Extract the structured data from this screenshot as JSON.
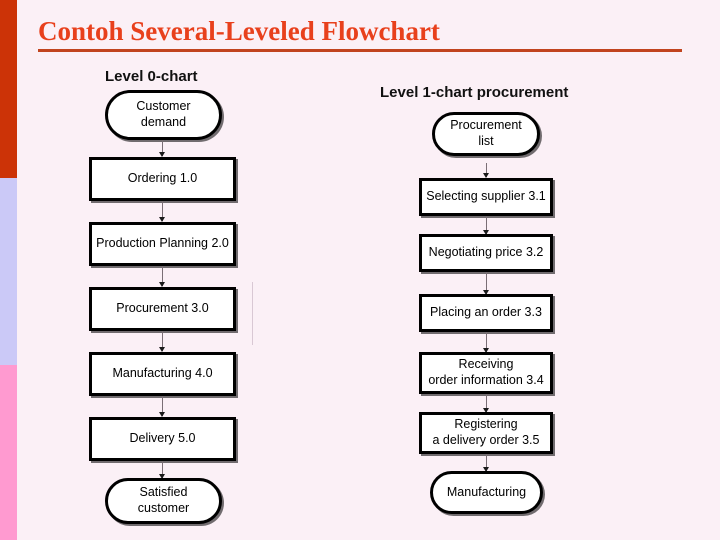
{
  "slide": {
    "title": "Contoh Several-Leveled Flowchart",
    "background_color": "#fbf0f6",
    "title_color": "#e8401c",
    "title_underline_color": "#c1441e"
  },
  "sidebar": {
    "bands": [
      {
        "name": "orange-band",
        "color": "#cc3307"
      },
      {
        "name": "lavender-band",
        "color": "#cbc9f7"
      },
      {
        "name": "pink-band",
        "color": "#ff9ad0"
      }
    ]
  },
  "columns": [
    {
      "heading": "Level 0-chart",
      "nodes": [
        {
          "label": "Customer\ndemand",
          "shape": "terminal"
        },
        {
          "label": "Ordering 1.0",
          "shape": "process"
        },
        {
          "label": "Production Planning 2.0",
          "shape": "process"
        },
        {
          "label": "Procurement 3.0",
          "shape": "process"
        },
        {
          "label": "Manufacturing 4.0",
          "shape": "process"
        },
        {
          "label": "Delivery 5.0",
          "shape": "process"
        },
        {
          "label": "Satisfied\ncustomer",
          "shape": "terminal"
        }
      ]
    },
    {
      "heading": "Level 1-chart procurement",
      "nodes": [
        {
          "label": "Procurement\nlist",
          "shape": "terminal"
        },
        {
          "label": "Selecting supplier 3.1",
          "shape": "process"
        },
        {
          "label": "Negotiating price 3.2",
          "shape": "process"
        },
        {
          "label": "Placing an order 3.3",
          "shape": "process"
        },
        {
          "label": "Receiving\norder information 3.4",
          "shape": "process"
        },
        {
          "label": "Registering\na delivery order 3.5",
          "shape": "process"
        },
        {
          "label": "Manufacturing",
          "shape": "terminal"
        }
      ]
    }
  ]
}
